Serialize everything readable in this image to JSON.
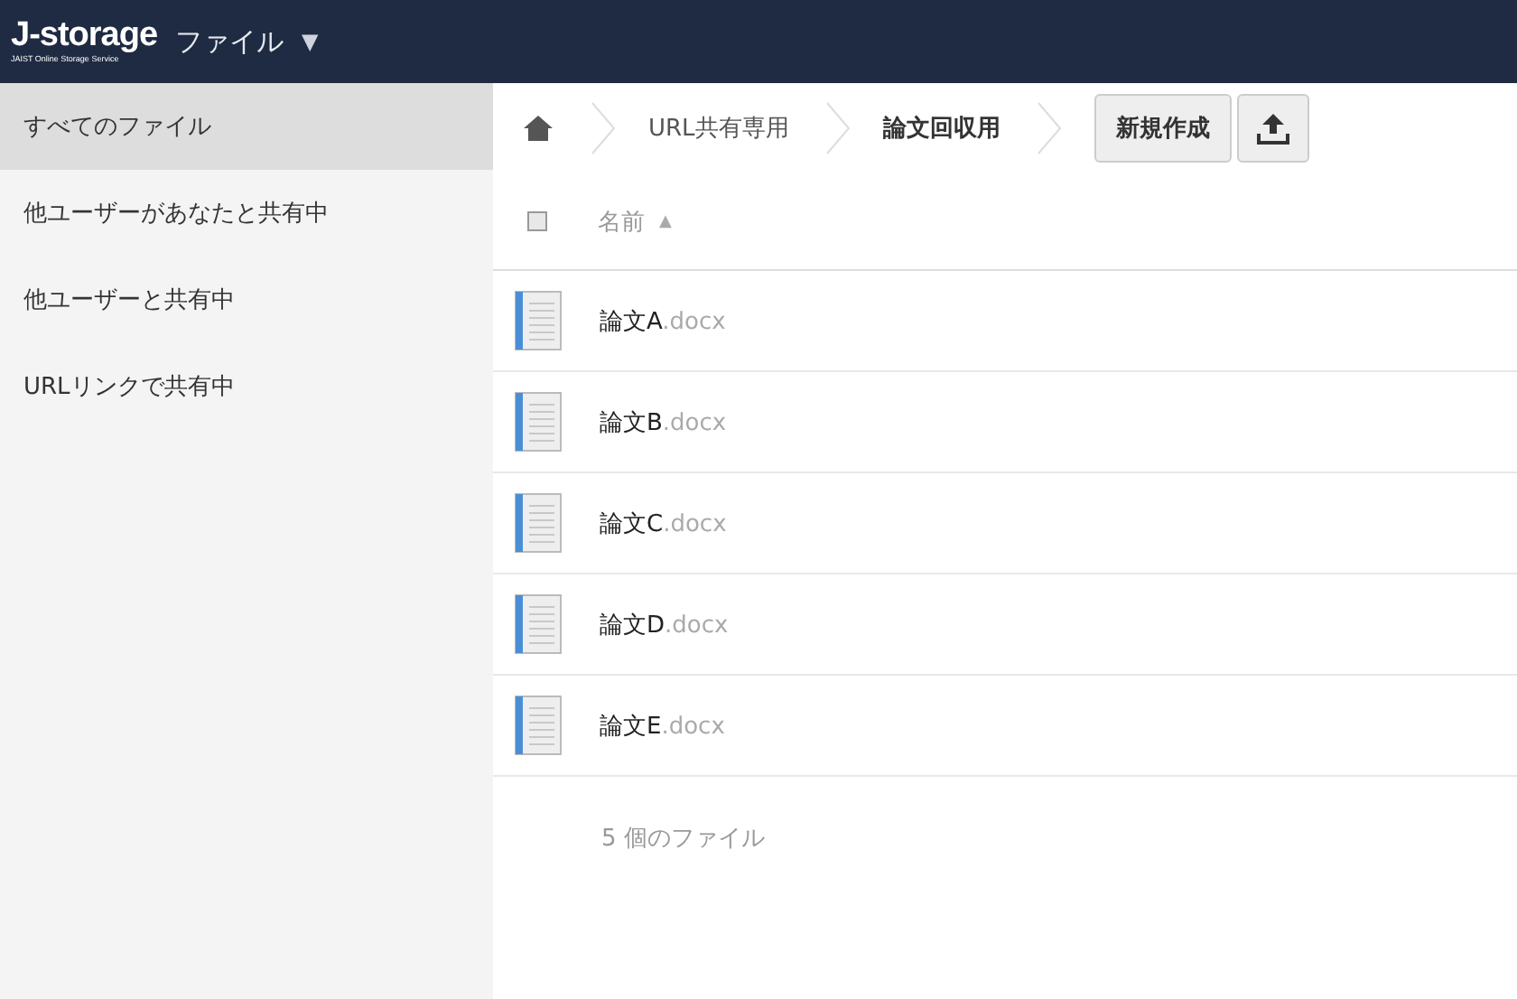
{
  "header": {
    "logo": "J-storage",
    "logo_subtitle": "JAIST Online Storage Service",
    "menu": "ファイル",
    "menu_caret": "▼"
  },
  "sidebar": {
    "items": [
      {
        "label": "すべてのファイル",
        "selected": true
      },
      {
        "label": "他ユーザーがあなたと共有中",
        "selected": false
      },
      {
        "label": "他ユーザーと共有中",
        "selected": false
      },
      {
        "label": "URLリンクで共有中",
        "selected": false
      }
    ]
  },
  "breadcrumb": [
    {
      "label": "URL共有専用",
      "current": false
    },
    {
      "label": "論文回収用",
      "current": true
    }
  ],
  "toolbar": {
    "new_button": "新規作成"
  },
  "table": {
    "select_all": {
      "checked": false
    },
    "columns": [
      {
        "label": "名前",
        "sort": "▲"
      }
    ],
    "rows": [
      {
        "name": "論文A",
        "ext": ".docx"
      },
      {
        "name": "論文B",
        "ext": ".docx"
      },
      {
        "name": "論文C",
        "ext": ".docx"
      },
      {
        "name": "論文D",
        "ext": ".docx"
      },
      {
        "name": "論文E",
        "ext": ".docx"
      }
    ]
  },
  "summary": "5 個のファイル"
}
